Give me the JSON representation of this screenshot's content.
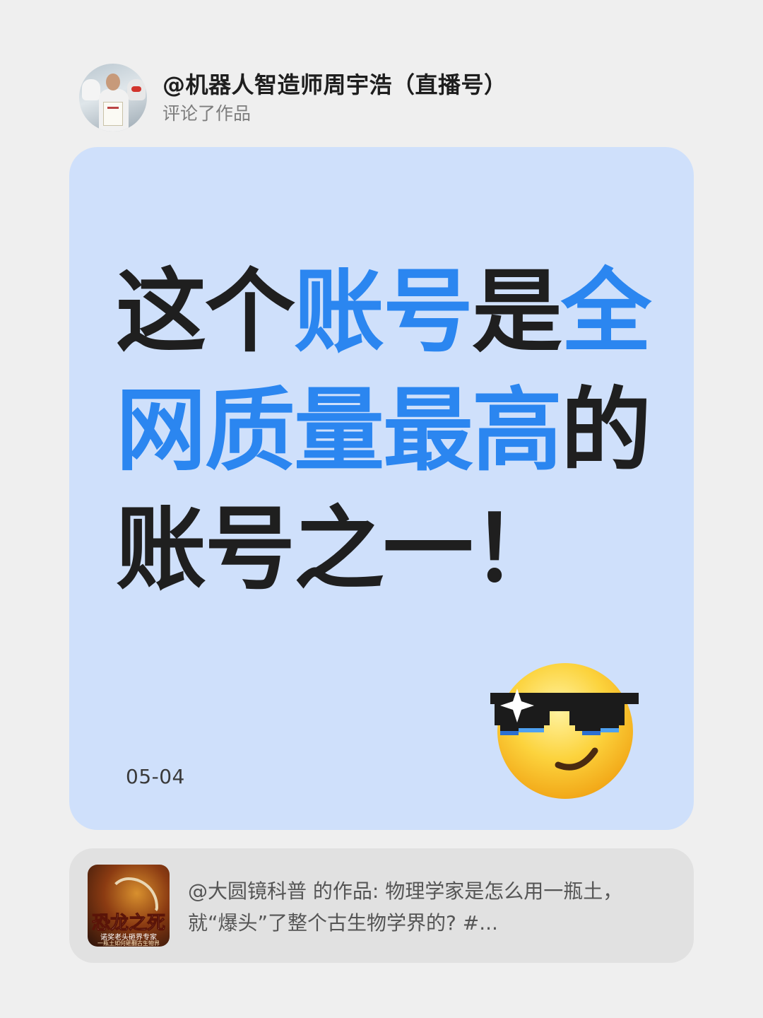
{
  "header": {
    "user_name": "@机器人智造师周宇浩（直播号）",
    "action": "评论了作品"
  },
  "card": {
    "lines": [
      [
        {
          "text": "这个",
          "hl": false
        },
        {
          "text": "账号",
          "hl": true
        },
        {
          "text": "是",
          "hl": false
        },
        {
          "text": "全",
          "hl": true
        }
      ],
      [
        {
          "text": "网质量最高",
          "hl": true
        },
        {
          "text": "的",
          "hl": false
        }
      ],
      [
        {
          "text": "账号之一！",
          "hl": false
        }
      ]
    ],
    "date": "05-04",
    "emoji": "cool-sunglasses-emoji",
    "colors": {
      "highlight": "#2b86f0",
      "text": "#1f1f1f",
      "background": "#cfe0fb"
    }
  },
  "quote": {
    "thumb_title": "恐龙之死",
    "thumb_subtitle": "诺奖老头砸界专家",
    "thumb_subtitle2": "一瓶土如何砸翻古生物界",
    "text": "@大圆镜科普 的作品: 物理学家是怎么用一瓶土，就“爆头”了整个古生物学界的? #..."
  }
}
